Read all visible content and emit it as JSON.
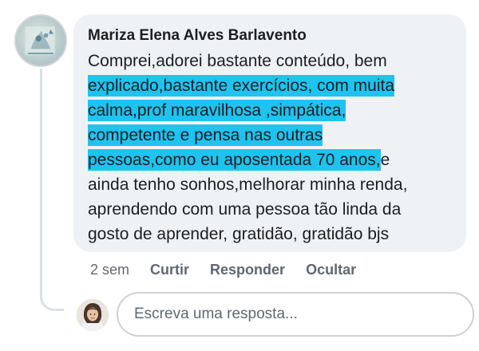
{
  "comment": {
    "author": "Mariza Elena Alves Barlavento",
    "lines": [
      {
        "pre": "Comprei,adorei  bastante conteúdo, bem",
        "hl": "",
        "post": ""
      },
      {
        "pre": "",
        "hl": "explicado,bastante exercícios, com muita",
        "post": ""
      },
      {
        "pre": "",
        "hl": "calma,prof maravilhosa  ,simpática,",
        "post": ""
      },
      {
        "pre": "",
        "hl": "competente e pensa nas outras",
        "post": ""
      },
      {
        "pre": "",
        "hl": "pessoas,como eu aposentada 70 anos,",
        "post": "e"
      },
      {
        "pre": "ainda tenho sonhos,melhorar minha renda,",
        "hl": "",
        "post": ""
      },
      {
        "pre": "aprendendo com uma pessoa tão  linda da",
        "hl": "",
        "post": ""
      },
      {
        "pre": "gosto de aprender, gratidão, gratidão  bjs",
        "hl": "",
        "post": ""
      }
    ],
    "highlight_color": "#1fc3f0",
    "timestamp": "2 sem",
    "actions": {
      "like": "Curtir",
      "reply": "Responder",
      "hide": "Ocultar"
    }
  },
  "reply": {
    "placeholder": "Escreva uma resposta..."
  }
}
